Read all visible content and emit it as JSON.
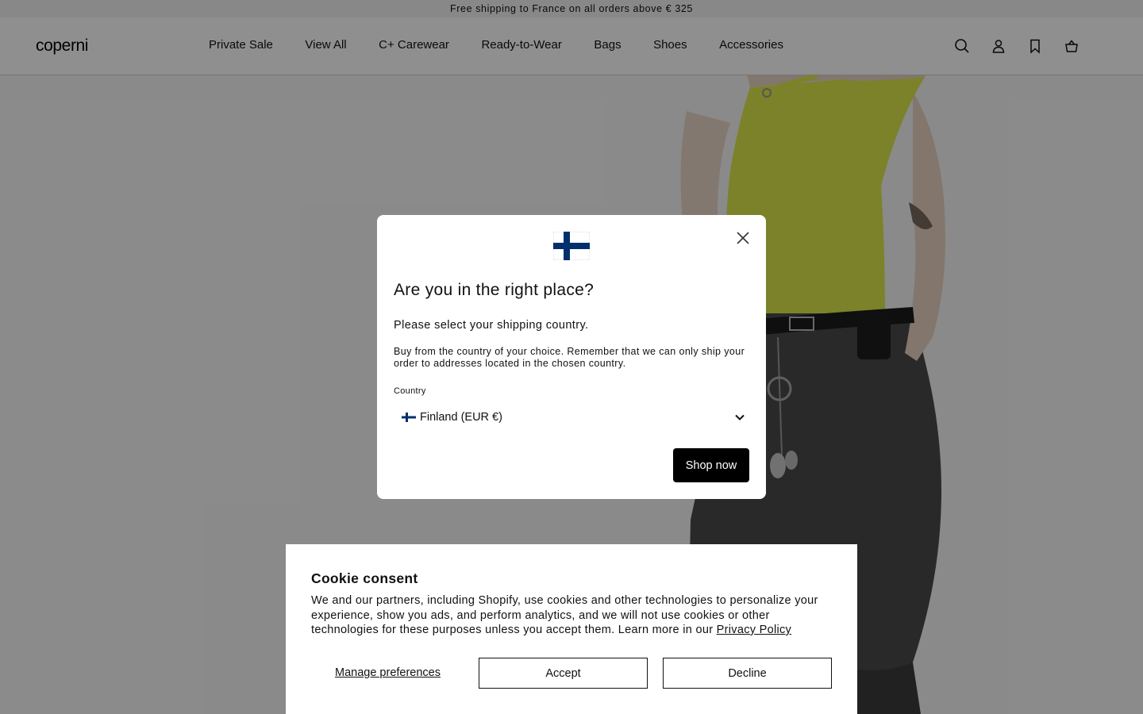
{
  "announcement": {
    "text": "Free shipping to France on all orders above € 325"
  },
  "header": {
    "logo": "coperni",
    "nav": [
      {
        "label": "Private Sale"
      },
      {
        "label": "View All"
      },
      {
        "label": "C+ Carewear"
      },
      {
        "label": "Ready-to-Wear"
      },
      {
        "label": "Bags"
      },
      {
        "label": "Shoes"
      },
      {
        "label": "Accessories"
      }
    ],
    "icons": [
      "search-icon",
      "account-icon",
      "wishlist-icon",
      "cart-icon"
    ]
  },
  "modal": {
    "flag": "finland-flag-icon",
    "title": "Are you in the right place?",
    "subtitle": "Please select your shipping country.",
    "body": "Buy from the country of your choice. Remember that we can only ship your order to addresses located in the chosen country.",
    "country_label": "Country",
    "country_value": "Finland (EUR €)",
    "cta": "Shop now"
  },
  "cookie": {
    "title": "Cookie consent",
    "text": "We and our partners, including Shopify, use cookies and other technologies to personalize your experience, show you ads, and perform analytics, and we will not use cookies or other technologies for these purposes unless you accept them. Learn more in our ",
    "link": "Privacy Policy",
    "manage": "Manage preferences",
    "accept": "Accept",
    "decline": "Decline"
  },
  "colors": {
    "flag_blue": "#002f6c",
    "top_color": "#dbe84a",
    "overlay": "rgba(0,0,0,0.44)"
  }
}
